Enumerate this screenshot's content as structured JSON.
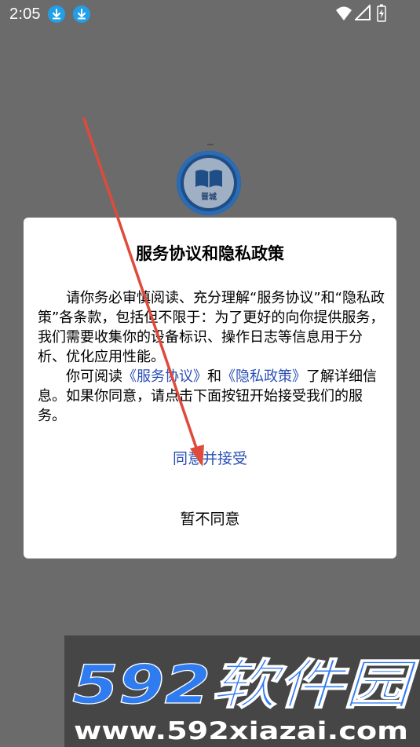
{
  "status_bar": {
    "time": "2:05",
    "icons": [
      "download-icon",
      "download-icon",
      "wifi-icon",
      "signal-icon",
      "battery-charging-icon"
    ]
  },
  "app": {
    "logo_text": "晋城"
  },
  "dialog": {
    "title": "服务协议和隐私政策",
    "paragraph1": "请你务必审慎阅读、充分理解“服务协议”和“隐私政策”各条款，包括但不限于：为了更好的向你提供服务，我们需要收集你的设备标识、操作日志等信息用于分析、优化应用性能。",
    "paragraph2_prefix": "你可阅读",
    "service_link": "《服务协议》",
    "paragraph2_and": "和",
    "privacy_link": "《隐私政策》",
    "paragraph2_suffix": "了解详细信息。如果你同意，请点击下面按钮开始接受我们的服务。",
    "accept_label": "同意并接受",
    "decline_label": "暂不同意"
  },
  "watermark": {
    "brand": "592软件园",
    "url": "www.592xiazai.com"
  },
  "colors": {
    "scrim": "#6b6b6b",
    "link": "#2a4fb5",
    "annotation_arrow": "#e04a3a",
    "download_badge": "#21a0e8"
  }
}
